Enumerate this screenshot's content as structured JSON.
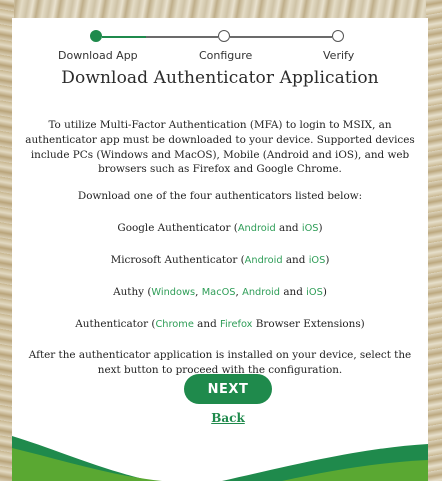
{
  "stepper": {
    "steps": [
      {
        "label": "Download App",
        "state": "active"
      },
      {
        "label": "Configure",
        "state": "pending"
      },
      {
        "label": "Verify",
        "state": "pending"
      }
    ]
  },
  "title": "Download Authenticator Application",
  "intro": "To utilize Multi-Factor Authentication (MFA) to login to MSIX, an authenticator app must be downloaded to your device. Supported devices include PCs (Windows and MacOS), Mobile (Android and iOS), and web browsers such as Firefox and Google Chrome.",
  "list_heading": "Download one of the four authenticators listed below:",
  "authenticators": [
    {
      "name": "Google Authenticator",
      "open": " (",
      "links": [
        "Android",
        "iOS"
      ],
      "joiners": [
        " and "
      ],
      "close": ")"
    },
    {
      "name": "Microsoft Authenticator",
      "open": " (",
      "links": [
        "Android",
        "iOS"
      ],
      "joiners": [
        " and "
      ],
      "close": ")"
    },
    {
      "name": "Authy",
      "open": " (",
      "links": [
        "Windows",
        "MacOS",
        "Android",
        "iOS"
      ],
      "joiners": [
        ", ",
        ", ",
        " and "
      ],
      "close": ")"
    },
    {
      "name": "Authenticator",
      "open": " (",
      "links": [
        "Chrome",
        "Firefox"
      ],
      "joiners": [
        " and "
      ],
      "close": " Browser Extensions)"
    }
  ],
  "outro": "After the authenticator application is installed on your device, select the next button to proceed with the configuration.",
  "buttons": {
    "next": "NEXT",
    "back": "Back"
  },
  "colors": {
    "primary": "#1f8a4c",
    "link": "#2e9d57"
  }
}
